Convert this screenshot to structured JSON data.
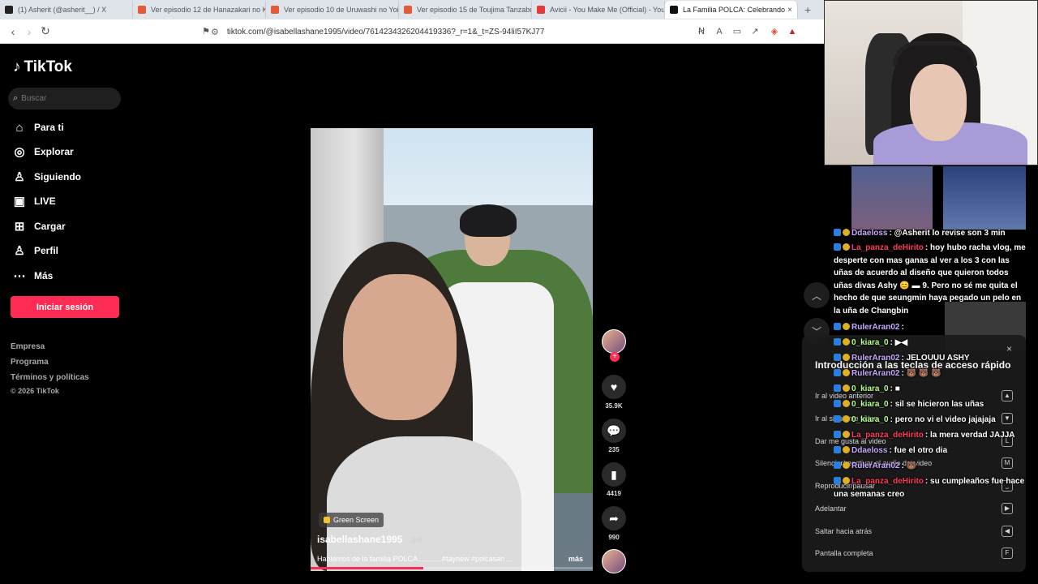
{
  "browser": {
    "tabs": [
      {
        "label": "(1) Asherit (@asherit__) / X",
        "fav": "#222222"
      },
      {
        "label": "Ver episodio 12 de Hanazakari no Kimi",
        "fav": "#e35a3a"
      },
      {
        "label": "Ver episodio 10 de Uruwashi no Yoi",
        "fav": "#e35a3a"
      },
      {
        "label": "Ver episodio 15 de Toujima Tanzaburou",
        "fav": "#e35a3a"
      },
      {
        "label": "Avicii - You Make Me (Official) - YouTube",
        "fav": "#e33a3a"
      },
      {
        "label": "La Familia POLCA: Celebrando",
        "fav": "#111111"
      }
    ],
    "new_tab": "+",
    "url": "tiktok.com/@isabellashane1995/video/7614234326204419336?_r=1&_t=ZS-94liI57KJ77"
  },
  "tiktok": {
    "logo": "TikTok",
    "search_placeholder": "Buscar",
    "nav": [
      {
        "label": "Para ti",
        "icon": "⌂"
      },
      {
        "label": "Explorar",
        "icon": "◎"
      },
      {
        "label": "Siguiendo",
        "icon": "♙"
      },
      {
        "label": "LIVE",
        "icon": "▣"
      },
      {
        "label": "Cargar",
        "icon": "⊞"
      },
      {
        "label": "Perfil",
        "icon": "♙"
      },
      {
        "label": "Más",
        "icon": "⋯"
      }
    ],
    "login": "Iniciar sesión",
    "footer": [
      "Empresa",
      "Programa",
      "Términos y políticas",
      "© 2026 TikTok"
    ]
  },
  "video": {
    "effect_badge": "Green Screen",
    "author": "isabellashane1995",
    "date": "· 3-6",
    "caption": "Hablemos de la familia POLCA............#taynew #polcasan ...",
    "more": "más",
    "progress": 0.4
  },
  "actions": {
    "likes": "35.9K",
    "comments": "235",
    "saves": "4419",
    "shares": "990"
  },
  "shortcuts": {
    "title": "Introducción a las teclas de acceso rápido",
    "close": "×",
    "items": [
      {
        "label": "Ir al video anterior",
        "key": "▲"
      },
      {
        "label": "Ir al siguiente video",
        "key": "▼"
      },
      {
        "label": "Dar me gusta al video",
        "key": "L"
      },
      {
        "label": "Silenciar/reactivar el audio del video",
        "key": "M"
      },
      {
        "label": "Reproducir/pausar",
        "key": "⎵"
      },
      {
        "label": "Adelantar",
        "key": "▶"
      },
      {
        "label": "Saltar hacia atrás",
        "key": "◀"
      },
      {
        "label": "Pantalla completa",
        "key": "F"
      }
    ]
  },
  "chat": [
    {
      "user": "Ddaeloss",
      "color": "#c9a8ff",
      "text": ": @Asherit lo revise son 3 min"
    },
    {
      "user": "La_panza_deHirito",
      "color": "#ff3b5c",
      "text": ": hoy hubo racha vlog, me desperte con mas ganas al ver a los 3 con las uñas de acuerdo al diseño que quieron todos uñas divas Ashy 😊 ▬ 9. Pero no sé me quita el hecho de que seungmin haya pegado un pelo en la uña de Changbin"
    },
    {
      "user": "RulerAran02",
      "color": "#c9a8ff",
      "text": ":"
    },
    {
      "user": "0_kiara_0",
      "color": "#b6ff8a",
      "text": ": ▶◀"
    },
    {
      "user": "RulerAran02",
      "color": "#c9a8ff",
      "text": ": JELOUUU ASHY"
    },
    {
      "user": "RulerAran02",
      "color": "#c9a8ff",
      "text": ": 🐻 🐻 🐻"
    },
    {
      "user": "0_kiara_0",
      "color": "#b6ff8a",
      "text": ": ■"
    },
    {
      "user": "0_kiara_0",
      "color": "#b6ff8a",
      "text": ": sil se hicieron las uñas"
    },
    {
      "user": "0_kiara_0",
      "color": "#b6ff8a",
      "text": ": pero no vi el video jajajaja"
    },
    {
      "user": "La_panza_deHirito",
      "color": "#ff3b5c",
      "text": ": la mera verdad JAJJA"
    },
    {
      "user": "Ddaeloss",
      "color": "#c9a8ff",
      "text": ": fue el otro dia"
    },
    {
      "user": "RulerAran02",
      "color": "#c9a8ff",
      "text": ": 🐻"
    },
    {
      "user": "La_panza_deHirito",
      "color": "#ff3b5c",
      "text": ": su cumpleaños fue hace una semanas creo"
    }
  ]
}
